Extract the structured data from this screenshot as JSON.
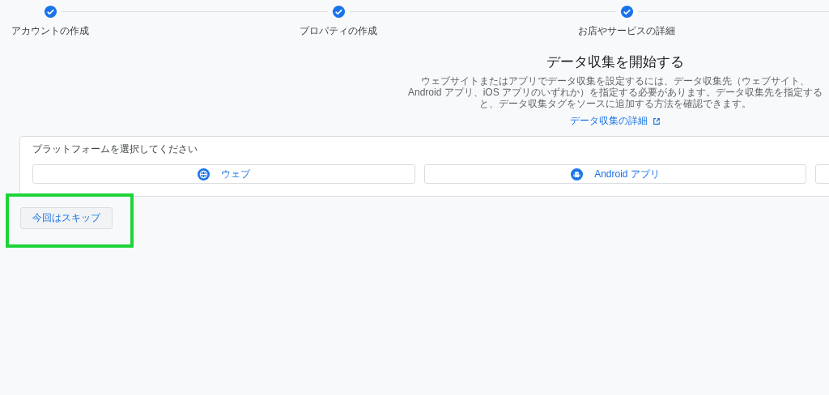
{
  "steps": [
    {
      "label": "アカウントの作成",
      "completed": true
    },
    {
      "label": "プロパティの作成",
      "completed": true
    },
    {
      "label": "お店やサービスの詳細",
      "completed": true
    }
  ],
  "heading": "データ収集を開始する",
  "description": "ウェブサイトまたはアプリでデータ収集を設定するには、データ収集先（ウェブサイト、Android アプリ、iOS アプリのいずれか）を指定する必要があります。データ収集先を指定すると、データ収集タグをソースに追加する方法を確認できます。",
  "details_link": "データ収集の詳細",
  "platform_card": {
    "prompt": "プラットフォームを選択してください",
    "options": [
      {
        "kind": "web",
        "label": "ウェブ"
      },
      {
        "kind": "android",
        "label": "Android アプリ"
      },
      {
        "kind": "blank"
      }
    ]
  },
  "skip_button": {
    "label": "今回はスキップ",
    "highlighted": true
  }
}
